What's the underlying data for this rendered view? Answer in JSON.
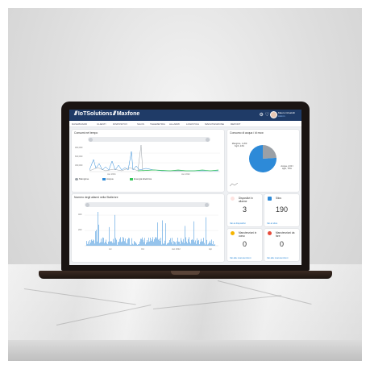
{
  "app": {
    "brand_left": "IoTSolutions",
    "brand_right": "Maxfone",
    "user_name": "Mauro Crisafulli",
    "user_role": "Admin"
  },
  "menu": [
    "DASHBOARD",
    "CLIENTI",
    "DISPOSITIVI",
    "SILOS",
    "TELEMETRIA",
    "ALLARMI",
    "LOGISTICA",
    "MANUTENZIONE",
    "REPORT"
  ],
  "panels": {
    "trend": {
      "title": "Consumi nel tempo",
      "y_ticks": [
        "900,000",
        "600,000",
        "300,000"
      ],
      "x_ticks": [
        "Jan 2021",
        "Jan 2022"
      ],
      "legend": [
        "Mangime",
        "Acqua",
        "Energia Elettrica"
      ]
    },
    "pie": {
      "title": "Consumo di acqua / di mcw",
      "label_left": "Mangime, 1,260\nKg/h, 24%",
      "label_right": "Acqua, 2,00 l\nkg/h, 76%"
    },
    "alarms": {
      "title": "Numero degli allarmi nella Stalle/ore",
      "y_ticks": [
        "400",
        "200"
      ],
      "x_ticks": [
        "Jul",
        "Oct",
        "Jan 2022",
        "Apr"
      ]
    }
  },
  "kpis": [
    {
      "title": "Dispositivi in allarme",
      "value": "3",
      "link": "Vai ai dispositivi"
    },
    {
      "title": "Silos",
      "value": "190",
      "link": "Vai ai silos"
    },
    {
      "title": "Manutenzioni in corso",
      "value": "0",
      "link": "Vai alle manutenzioni"
    },
    {
      "title": "Manutenzioni da fare",
      "value": "0",
      "link": "Vai alle manutenzioni"
    }
  ],
  "colors": {
    "topbar": "#1f3b67",
    "accent": "#2d8ad8",
    "green": "#34c759",
    "gray": "#9aa0a6",
    "alert": "#e74c3c",
    "warning": "#f5b400"
  },
  "chart_data": [
    {
      "type": "pie",
      "categories": [
        "Mangime",
        "Acqua"
      ],
      "values": [
        24,
        76
      ]
    }
  ]
}
